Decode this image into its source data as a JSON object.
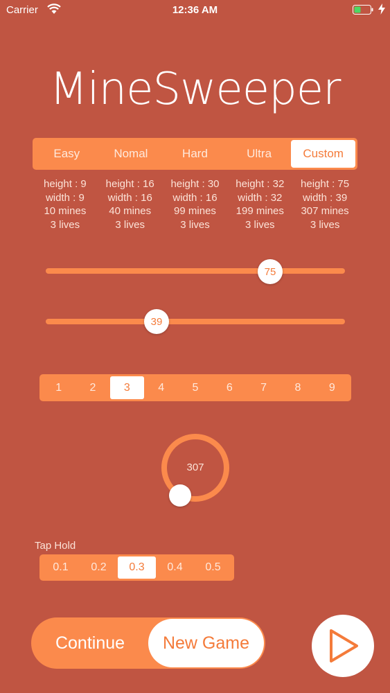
{
  "status_bar": {
    "carrier": "Carrier",
    "time": "12:36 AM"
  },
  "title": "MineSweeper",
  "difficulty": {
    "options": [
      "Easy",
      "Nomal",
      "Hard",
      "Ultra",
      "Custom"
    ],
    "selected": "Custom"
  },
  "levels": [
    {
      "height": "height : 9",
      "width": "width : 9",
      "mines": "10 mines",
      "lives": "3 lives"
    },
    {
      "height": "height : 16",
      "width": "width : 16",
      "mines": "40 mines",
      "lives": "3 lives"
    },
    {
      "height": "height : 30",
      "width": "width : 16",
      "mines": "99 mines",
      "lives": "3 lives"
    },
    {
      "height": "height : 32",
      "width": "width : 32",
      "mines": "199 mines",
      "lives": "3 lives"
    },
    {
      "height": "height : 75",
      "width": "width : 39",
      "mines": "307 mines",
      "lives": "3 lives"
    }
  ],
  "height_slider": {
    "value": "75"
  },
  "width_slider": {
    "value": "39"
  },
  "lives_selector": {
    "options": [
      "1",
      "2",
      "3",
      "4",
      "5",
      "6",
      "7",
      "8",
      "9"
    ],
    "selected": "3"
  },
  "mines_dial": {
    "value": "307"
  },
  "tap_hold": {
    "label": "Tap Hold",
    "options": [
      "0.1",
      "0.2",
      "0.3",
      "0.4",
      "0.5"
    ],
    "selected": "0.3"
  },
  "game_toggle": {
    "continue_label": "Continue",
    "new_game_label": "New Game"
  },
  "colors": {
    "background": "#C05542",
    "accent": "#FB8A4C",
    "highlight": "#F47B3A"
  }
}
